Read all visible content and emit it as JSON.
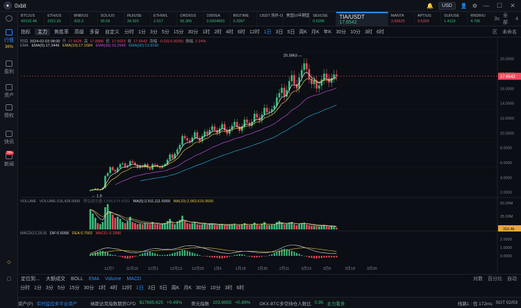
{
  "app": {
    "name": "0xbit",
    "currency": "USD"
  },
  "sidebar": [
    {
      "label": "行情",
      "active": true
    },
    {
      "label": "盈利"
    },
    {
      "label": "资产"
    },
    {
      "label": "授权"
    },
    {
      "label": "快讯"
    },
    {
      "label": "新闻",
      "badge": "99+"
    }
  ],
  "sidebar_top_label": "36%",
  "tickers": [
    {
      "name": "BTC/US",
      "price": "43192.48",
      "dir": "up"
    },
    {
      "name": "ETH/US",
      "price": "2321.81",
      "dir": "up"
    },
    {
      "name": "BNB/US",
      "price": "303.3",
      "dir": "up"
    },
    {
      "name": "SOL/US",
      "price": "99.55",
      "dir": "up"
    },
    {
      "name": "INJ/USE",
      "price": "34.320",
      "dir": "up"
    },
    {
      "name": "ETHW/L",
      "price": "2.917",
      "dir": "up"
    },
    {
      "name": "ORDI/US",
      "price": "56.366",
      "dir": "up"
    },
    {
      "name": "1000SA",
      "price": "0.0004650",
      "dir": "up"
    },
    {
      "name": "BIGTIME",
      "price": "0.3367",
      "dir": "up"
    },
    {
      "name": "USDT 场外-OKX",
      "price": "",
      "dir": "up"
    },
    {
      "name": "美国10年期国债收",
      "price": "",
      "dir": "up"
    },
    {
      "name": "SEI/USE",
      "price": "0.6206",
      "dir": "up"
    },
    {
      "name": "TIA/USDT",
      "price": "17.6542",
      "dir": "up",
      "active": true
    },
    {
      "name": "MANTA",
      "price": "3.00625",
      "dir": "dn"
    },
    {
      "name": "APT/US",
      "price": "9.5300",
      "dir": "dn"
    },
    {
      "name": "SUI/USE",
      "price": "1.4119",
      "dir": "up"
    },
    {
      "name": "RNDR/U",
      "price": "4.796",
      "dir": "up"
    }
  ],
  "tickers_right": {
    "count": "3s",
    "label": "全部",
    "level": "4"
  },
  "toolbar": {
    "items": [
      "指标",
      "主力",
      "焦胜率",
      "高级",
      "多窗",
      "自定义"
    ],
    "periods": [
      "分时",
      "1分",
      "3分",
      "5分",
      "15分",
      "30分",
      "1时",
      "2时",
      "4时",
      "6时",
      "12时",
      "1日",
      "3日",
      "5日",
      "周K",
      "月K",
      "年K",
      "30分",
      "10分",
      "3时",
      "6时"
    ],
    "active_period": "1日",
    "right": [
      "区",
      "未命名"
    ]
  },
  "info": {
    "line1": [
      {
        "k": "时间",
        "v": "2024-02-03 08:00"
      },
      {
        "k": "开",
        "v": "17.6626"
      },
      {
        "k": "高",
        "v": "17.8986"
      },
      {
        "k": "低",
        "v": "17.5023"
      },
      {
        "k": "收",
        "v": "17.6542"
      },
      {
        "k": "涨幅",
        "v": "-0.02(-0.0039)"
      },
      {
        "k": "振幅",
        "v": "2.24%"
      }
    ],
    "ema": {
      "label": "EMA",
      "e5": "EMA(5):17.3446",
      "e10": "EMA(10):17.1584",
      "e30": "EMA(30):16.2548",
      "e60": "EMA(60):13.9160"
    },
    "vol": {
      "label": "VOLUME",
      "v": "VOLUME:316,428.5000",
      "pred": "预估成交量:1,555,674.4281",
      "ma5": "MA(5):2,911,111.5000",
      "ma10": "MA(10):2,963,615.0600"
    },
    "macd": {
      "label": "MACD(12,26,9)",
      "dif": "DIF:0.6058",
      "dea": "DEA:0.7002",
      "macd": "MACD:-0.1888"
    }
  },
  "chart_data": {
    "type": "candlestick",
    "price_axis": [
      20,
      18,
      16,
      14,
      12,
      10,
      8,
      6,
      4,
      2
    ],
    "price_ylim": [
      1.5,
      21
    ],
    "high_label": "20.3963",
    "low_label": "1.9",
    "last_price": "17.6542",
    "dates": [
      "11月7",
      "11月19",
      "12月1",
      "12月13",
      "12月25",
      "1月6",
      "1月18",
      "1月30",
      "2月11",
      "2月23",
      "3月6",
      "3月18",
      "3月30"
    ],
    "volume_axis": [
      "50.00M",
      "25.00M"
    ],
    "volume_last": "316.4k",
    "macd_axis": [
      "2.0000",
      "1.0000",
      "0.0000"
    ],
    "closes": [
      2.3,
      2.4,
      2.5,
      2.3,
      2.4,
      2.6,
      4.2,
      4.6,
      5.4,
      5.0,
      4.8,
      5.3,
      5.8,
      5.9,
      5.4,
      5.6,
      6.2,
      6.0,
      5.7,
      5.3,
      5.6,
      5.4,
      5.8,
      5.3,
      5.1,
      5.8,
      5.7,
      5.5,
      5.3,
      5.6,
      5.8,
      6.4,
      7.1,
      6.6,
      7.2,
      7.8,
      8.4,
      9.6,
      9.3,
      9.0,
      8.8,
      9.4,
      10.1,
      9.3,
      8.9,
      9.6,
      10.2,
      9.8,
      10.4,
      10.9,
      10.4,
      10.0,
      10.6,
      11.2,
      10.4,
      9.9,
      10.5,
      11.0,
      11.5,
      10.9,
      10.3,
      10.9,
      11.8,
      11.4,
      11.0,
      11.5,
      12.6,
      12.1,
      11.7,
      12.5,
      13.4,
      12.8,
      12.9,
      13.2,
      13.7,
      14.8,
      15.4,
      16.1,
      14.9,
      15.8,
      17.0,
      17.8,
      16.6,
      16.0,
      17.5,
      18.5,
      19.4,
      18.6,
      17.3,
      16.6,
      17.1,
      16.0,
      16.4,
      17.2,
      18.0,
      17.4,
      16.8,
      17.4,
      17.9,
      17.6542
    ],
    "volumes": [
      38,
      30,
      22,
      12,
      10,
      14,
      42,
      48,
      34,
      28,
      22,
      24,
      20,
      14,
      12,
      16,
      24,
      14,
      12,
      10,
      11,
      10,
      12,
      11,
      10,
      14,
      10,
      10,
      9,
      10,
      12,
      16,
      20,
      12,
      10,
      15,
      18,
      26,
      16,
      12,
      11,
      12,
      14,
      10,
      9,
      10,
      11,
      9,
      10,
      11,
      9,
      8,
      9,
      10,
      8,
      8,
      9,
      10,
      11,
      8,
      8,
      10,
      12,
      9,
      8,
      10,
      13,
      9,
      8,
      11,
      14,
      9,
      8,
      9,
      10,
      14,
      16,
      13,
      10,
      11,
      13,
      14,
      10,
      8,
      11,
      12,
      13,
      10,
      8,
      7,
      7,
      6,
      6,
      7,
      8,
      6,
      5,
      6,
      5,
      3
    ],
    "macd_hist": [
      0.2,
      0.3,
      0.4,
      0.5,
      0.6,
      0.6,
      0.5,
      0.4,
      0.2,
      0.1,
      0.1,
      0.0,
      -0.1,
      -0.2,
      -0.3,
      -0.35,
      -0.3,
      -0.2,
      -0.1,
      0.0,
      0.15,
      0.3,
      0.4,
      0.45,
      0.5,
      0.4,
      0.3,
      0.2,
      0.1,
      0.1,
      0.1,
      0.15,
      0.2,
      0.3,
      0.4,
      0.5,
      0.6,
      0.7,
      0.7,
      0.6,
      0.5,
      0.4,
      0.3,
      0.2,
      0.1,
      0.0,
      -0.05,
      -0.1,
      -0.15,
      -0.2,
      -0.2,
      -0.25,
      -0.3,
      -0.3,
      -0.25,
      -0.2,
      -0.1,
      0.0,
      0.1,
      0.15,
      0.2,
      0.2,
      0.1,
      0.0,
      -0.1,
      -0.15,
      -0.2,
      -0.2,
      -0.15,
      -0.1,
      -0.05,
      0.0,
      0.1,
      0.2,
      0.35,
      0.5,
      0.65,
      0.8,
      0.85,
      0.8,
      0.7,
      0.6,
      0.5,
      0.35,
      0.25,
      0.1,
      0.0,
      -0.1,
      -0.2,
      -0.25,
      -0.3,
      -0.3,
      -0.28,
      -0.25,
      -0.22,
      -0.2,
      -0.2,
      -0.19,
      -0.19,
      -0.1888
    ]
  },
  "bottom": {
    "left": [
      "定位到…",
      "大额成交",
      "BOLL",
      "EMA",
      "Volume",
      "MACD"
    ],
    "right": [
      "对数",
      "百分比",
      "自动"
    ]
  },
  "bottom_periods": [
    "分时",
    "1分",
    "3分",
    "5分",
    "15分",
    "30分",
    "1时",
    "4时",
    "12时",
    "1日",
    "3日",
    "5日",
    "周K",
    "月K",
    "30分",
    "10分",
    "3时",
    "6时"
  ],
  "status": {
    "asset": "资产(P)",
    "monitor": "实时监控多平台资产",
    "index1": "纳斯达克指数期货CFD",
    "index1_val": "$17695.625",
    "index1_chg": "+0.49%",
    "index2": "美元指数",
    "index2_val": "103.9655",
    "index2_chg": "+0.89%",
    "index3": "OKX-BTC多空持仓人数比",
    "index3_val": "0.95",
    "index3_tag": "主力看多",
    "line": "线路1 : 优 172ms",
    "clock": "SGT 02/03"
  }
}
